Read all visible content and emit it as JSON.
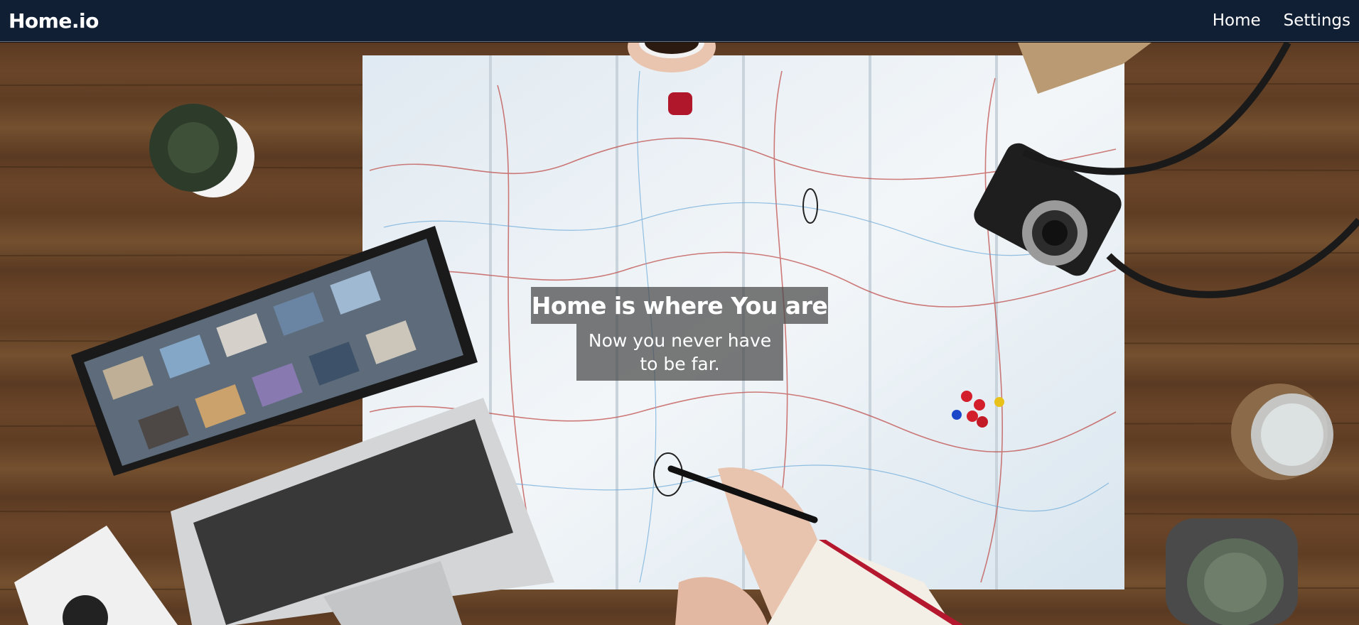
{
  "navbar": {
    "brand": "Home.io",
    "links": [
      {
        "label": "Home"
      },
      {
        "label": "Settings"
      }
    ]
  },
  "hero": {
    "title": "Home is where You are",
    "subtitle": "Now you never have to be far.",
    "background_description_icon": "travel-desk-photo"
  },
  "colors": {
    "navbar_bg": "#111f35",
    "text": "#ffffff",
    "overlay": "#464646"
  }
}
